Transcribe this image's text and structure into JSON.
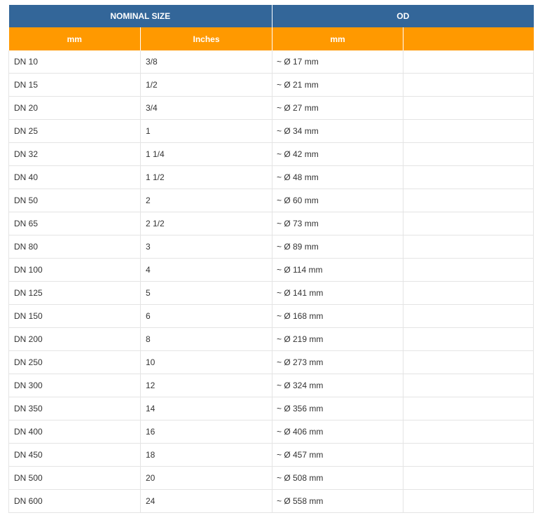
{
  "header": {
    "nominal_size": "NOMINAL SIZE",
    "od": "OD"
  },
  "subheader": {
    "col1": "mm",
    "col2": "Inches",
    "col3": "mm",
    "col4": ""
  },
  "rows": [
    {
      "dn": "DN 10",
      "inches": "3/8",
      "od": "~ Ø 17 mm"
    },
    {
      "dn": "DN 15",
      "inches": "1/2",
      "od": "~ Ø 21 mm"
    },
    {
      "dn": "DN 20",
      "inches": "3/4",
      "od": "~ Ø 27 mm"
    },
    {
      "dn": "DN 25",
      "inches": "1",
      "od": "~ Ø 34 mm"
    },
    {
      "dn": "DN 32",
      "inches": "1 1/4",
      "od": "~ Ø 42 mm"
    },
    {
      "dn": "DN 40",
      "inches": "1 1/2",
      "od": "~ Ø 48 mm"
    },
    {
      "dn": "DN 50",
      "inches": "2",
      "od": "~ Ø 60 mm"
    },
    {
      "dn": "DN 65",
      "inches": "2 1/2",
      "od": "~ Ø 73 mm"
    },
    {
      "dn": "DN 80",
      "inches": "3",
      "od": "~ Ø 89 mm"
    },
    {
      "dn": "DN 100",
      "inches": "4",
      "od": "~ Ø 114 mm"
    },
    {
      "dn": "DN 125",
      "inches": "5",
      "od": "~ Ø 141 mm"
    },
    {
      "dn": "DN 150",
      "inches": "6",
      "od": "~ Ø 168 mm"
    },
    {
      "dn": "DN 200",
      "inches": "8",
      "od": "~ Ø 219 mm"
    },
    {
      "dn": "DN 250",
      "inches": "10",
      "od": "~ Ø 273 mm"
    },
    {
      "dn": "DN 300",
      "inches": "12",
      "od": "~ Ø 324 mm"
    },
    {
      "dn": "DN 350",
      "inches": "14",
      "od": "~ Ø 356 mm"
    },
    {
      "dn": "DN 400",
      "inches": "16",
      "od": "~ Ø 406 mm"
    },
    {
      "dn": "DN 450",
      "inches": "18",
      "od": "~ Ø 457 mm"
    },
    {
      "dn": "DN 500",
      "inches": "20",
      "od": "~ Ø 508 mm"
    },
    {
      "dn": "DN 600",
      "inches": "24",
      "od": "~ Ø 558 mm"
    }
  ],
  "colors": {
    "header_blue": "#336699",
    "subheader_orange": "#ff9900",
    "border_gray": "#e4e4e4",
    "text": "#333333"
  }
}
